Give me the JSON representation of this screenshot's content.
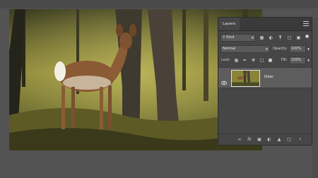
{
  "layers_panel": {
    "tab_title": "Layers",
    "filter": {
      "kind_value": "Kind"
    },
    "blend": {
      "mode_value": "Normal",
      "opacity_label": "Opacity:",
      "opacity_value": "100%"
    },
    "lock": {
      "label": "Lock:",
      "fill_label": "Fill:",
      "fill_value": "100%"
    },
    "layers": [
      {
        "name": "Deer",
        "visible": true
      }
    ]
  },
  "colors": {
    "workspace_bg": "#535353",
    "panel_bg": "#464646",
    "panel_header_bg": "#3a3a3a",
    "selected_layer_bg": "#5d5d5d",
    "text": "#e6e6e6"
  },
  "icons": {
    "filter_icons": [
      "image-filter-icon",
      "adjustment-filter-icon",
      "type-filter-icon",
      "shape-filter-icon",
      "smart-object-filter-icon",
      "filter-toggle-icon"
    ],
    "lock_icons": [
      "lock-transparent-pixels-icon",
      "lock-image-pixels-icon",
      "lock-position-icon",
      "lock-artboard-icon",
      "lock-all-icon"
    ],
    "bottom_icons": [
      "link-layers-icon",
      "layer-style-fx-icon",
      "add-mask-icon",
      "adjustment-layer-icon",
      "new-group-icon",
      "new-layer-icon",
      "delete-layer-icon"
    ]
  }
}
